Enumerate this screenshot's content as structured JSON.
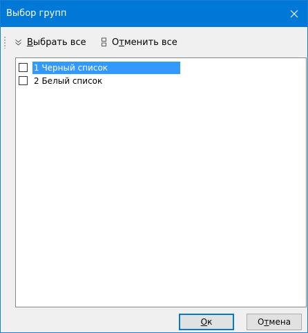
{
  "window": {
    "title": "Выбор групп"
  },
  "toolbar": {
    "select_all": {
      "mnemonic": "В",
      "rest": "ыбрать все"
    },
    "deselect_all": {
      "pre": "О",
      "mnemonic": "т",
      "rest": "менить все"
    }
  },
  "list": {
    "items": [
      {
        "label": "1 Черный список",
        "checked": false,
        "selected": true
      },
      {
        "label": "2 Белый список",
        "checked": false,
        "selected": false
      }
    ]
  },
  "buttons": {
    "ok": {
      "mnemonic": "О",
      "rest": "к"
    },
    "cancel": {
      "pre": "О",
      "mnemonic": "т",
      "rest": "мена"
    }
  }
}
